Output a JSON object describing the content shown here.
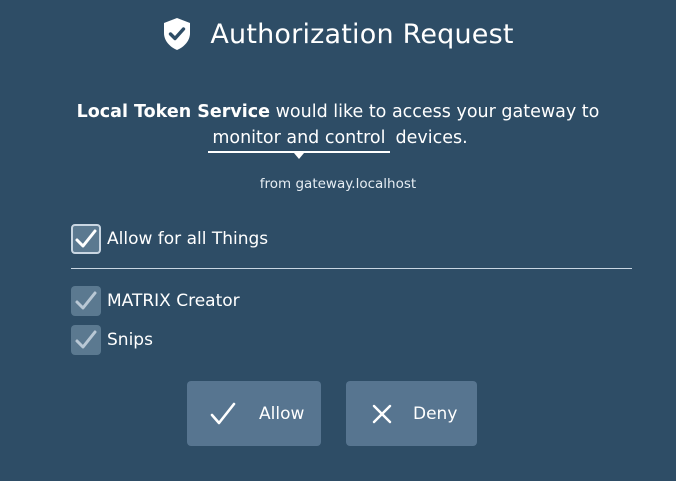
{
  "header": {
    "title": "Authorization Request",
    "icon": "shield-check-icon"
  },
  "request": {
    "app_name": "Local Token Service",
    "text_before": "would like to access your gateway to",
    "scope_selected": "monitor and control",
    "text_after": "devices."
  },
  "origin": "from gateway.localhost",
  "allow_all": {
    "label": "Allow for all Things",
    "checked": true
  },
  "things": [
    {
      "label": "MATRIX Creator",
      "checked": true
    },
    {
      "label": "Snips",
      "checked": true
    }
  ],
  "buttons": {
    "allow_label": "Allow",
    "deny_label": "Deny"
  },
  "colors": {
    "background": "#2e4d66",
    "button": "#577590",
    "checkbox": "#5b7990"
  }
}
